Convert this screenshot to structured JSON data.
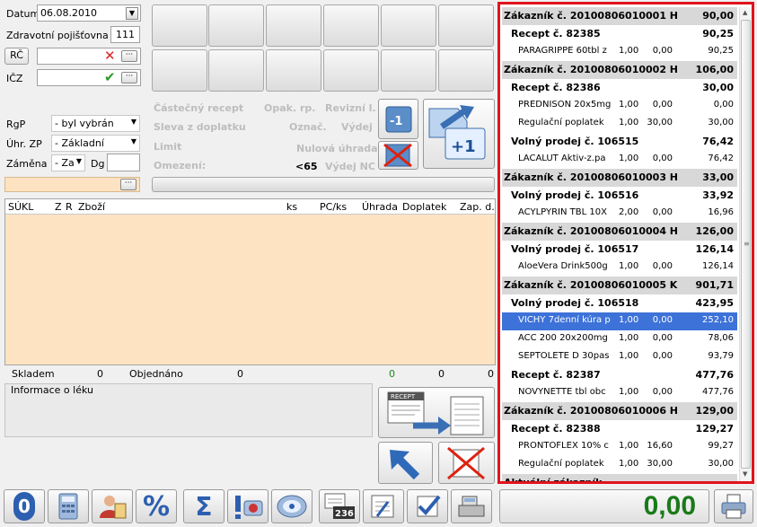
{
  "form": {
    "datum_label": "Datum",
    "datum_value": "06.08.2010",
    "pojistovna_label": "Zdravotní pojišťovna",
    "pojistovna_value": "111",
    "rc_label": "RČ",
    "icz_label": "IČZ",
    "rgp_label": "RgP",
    "rgp_value": "- byl vybrán",
    "uhr_label": "Úhr. ZP",
    "uhr_value": "- Základní",
    "zamena_label": "Záměna",
    "zamena_value": "- Za",
    "dg_label": "Dg",
    "ellipsis": "···"
  },
  "options": {
    "castecny": "Částečný recept",
    "opak": "Opak. rp.",
    "revizni": "Revizní l.",
    "sleva": "Sleva z doplatku",
    "oznac": "Označ.",
    "vydej": "Výdej",
    "limit": "Limit",
    "nulova": "Nulová úhrada",
    "omezeni": "Omezení:",
    "lt65": "<65",
    "vydej_nc": "Výdej NC"
  },
  "qty": {
    "minus": "-1",
    "plus": "+1"
  },
  "table": {
    "headers": [
      "SÚKL",
      "Z",
      "R",
      "Zboží",
      "ks",
      "PC/ks",
      "Úhrada",
      "Doplatek",
      "Zap. d."
    ]
  },
  "bottom": {
    "skladem_label": "Skladem",
    "skladem_value": "0",
    "objednano_label": "Objednáno",
    "objednano_value": "0",
    "v1": "0",
    "v2": "0",
    "v3": "0",
    "info_label": "Informace o léku",
    "recept_icon_text": "RECEPT"
  },
  "toolbar": {
    "zero": "0",
    "pct": "%",
    "sigma": "Σ",
    "num": "236"
  },
  "total": "0,00",
  "accent": "#e0141e",
  "right_list": [
    {
      "kind": "customer",
      "text": "Zákazník č. 20100806010001 H",
      "c3": "90,00"
    },
    {
      "kind": "sub",
      "text": "Recept č. 82385",
      "c3": "90,25"
    },
    {
      "kind": "item",
      "text": "PARAGRIPPE 60tbl z",
      "c1": "1,00",
      "c2": "0,00",
      "c3": "90,25"
    },
    {
      "kind": "customer",
      "text": "Zákazník č. 20100806010002 H",
      "c3": "106,00"
    },
    {
      "kind": "sub",
      "text": "Recept č. 82386",
      "c3": "30,00"
    },
    {
      "kind": "item",
      "text": "PREDNISON 20x5mg",
      "c1": "1,00",
      "c2": "0,00",
      "c3": "0,00"
    },
    {
      "kind": "item",
      "text": "Regulační poplatek",
      "c1": "1,00",
      "c2": "30,00",
      "c3": "30,00"
    },
    {
      "kind": "sub",
      "text": "Volný prodej č. 106515",
      "c3": "76,42"
    },
    {
      "kind": "item",
      "text": "LACALUT Aktiv-z.pa",
      "c1": "1,00",
      "c2": "0,00",
      "c3": "76,42"
    },
    {
      "kind": "customer",
      "text": "Zákazník č. 20100806010003 H",
      "c3": "33,00"
    },
    {
      "kind": "sub",
      "text": "Volný prodej č. 106516",
      "c3": "33,92"
    },
    {
      "kind": "item",
      "text": "ACYLPYRIN TBL 10X",
      "c1": "2,00",
      "c2": "0,00",
      "c3": "16,96"
    },
    {
      "kind": "customer",
      "text": "Zákazník č. 20100806010004 H",
      "c3": "126,00"
    },
    {
      "kind": "sub",
      "text": "Volný prodej č. 106517",
      "c3": "126,14"
    },
    {
      "kind": "item",
      "text": "AloeVera Drink500g",
      "c1": "1,00",
      "c2": "0,00",
      "c3": "126,14"
    },
    {
      "kind": "customer",
      "text": "Zákazník č. 20100806010005 K",
      "c3": "901,71"
    },
    {
      "kind": "sub",
      "text": "Volný prodej č. 106518",
      "c3": "423,95"
    },
    {
      "kind": "selected",
      "text": "VICHY 7denní kúra p",
      "c1": "1,00",
      "c2": "0,00",
      "c3": "252,10"
    },
    {
      "kind": "item",
      "text": "ACC 200 20x200mg",
      "c1": "1,00",
      "c2": "0,00",
      "c3": "78,06"
    },
    {
      "kind": "item",
      "text": "SEPTOLETE D 30pas",
      "c1": "1,00",
      "c2": "0,00",
      "c3": "93,79"
    },
    {
      "kind": "sub",
      "text": "Recept č. 82387",
      "c3": "477,76"
    },
    {
      "kind": "item",
      "text": "NOVYNETTE tbl obc",
      "c1": "1,00",
      "c2": "0,00",
      "c3": "477,76"
    },
    {
      "kind": "customer",
      "text": "Zákazník č. 20100806010006 H",
      "c3": "129,00"
    },
    {
      "kind": "sub",
      "text": "Recept č. 82388",
      "c3": "129,27"
    },
    {
      "kind": "item",
      "text": "PRONTOFLEX 10% c",
      "c1": "1,00",
      "c2": "16,60",
      "c3": "99,27"
    },
    {
      "kind": "item",
      "text": "Regulační poplatek",
      "c1": "1,00",
      "c2": "30,00",
      "c3": "30,00"
    },
    {
      "kind": "customer",
      "text": "Aktuální zákazník",
      "c3": ""
    }
  ]
}
